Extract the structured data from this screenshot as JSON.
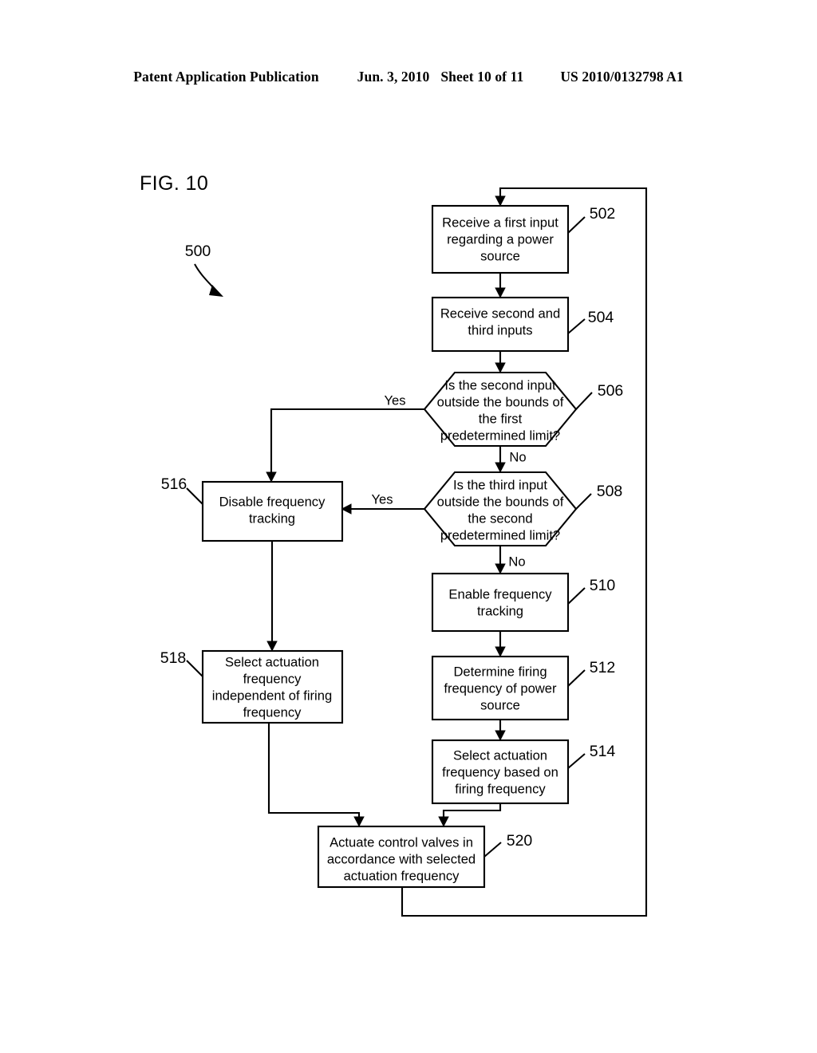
{
  "header": {
    "title": "Patent Application Publication",
    "date": "Jun. 3, 2010",
    "sheet": "Sheet 10 of 11",
    "publication_number": "US 2010/0132798 A1"
  },
  "figure": {
    "label": "FIG. 10",
    "diagram_reference": "500"
  },
  "colors": {
    "ink": "#000000",
    "paper": "#ffffff"
  },
  "flowchart": {
    "type": "flowchart",
    "nodes": [
      {
        "id": "502",
        "shape": "process",
        "ref": "502",
        "lines": [
          "Receive a first input",
          "regarding a power",
          "source"
        ]
      },
      {
        "id": "504",
        "shape": "process",
        "ref": "504",
        "lines": [
          "Receive second and",
          "third inputs"
        ]
      },
      {
        "id": "506",
        "shape": "decision",
        "ref": "506",
        "lines": [
          "Is the second input",
          "outside the bounds of",
          "the first",
          "predetermined limit?"
        ]
      },
      {
        "id": "508",
        "shape": "decision",
        "ref": "508",
        "lines": [
          "Is the third input",
          "outside the bounds of",
          "the second",
          "predetermined limit?"
        ]
      },
      {
        "id": "510",
        "shape": "process",
        "ref": "510",
        "lines": [
          "Enable frequency",
          "tracking"
        ]
      },
      {
        "id": "512",
        "shape": "process",
        "ref": "512",
        "lines": [
          "Determine firing",
          "frequency of power",
          "source"
        ]
      },
      {
        "id": "514",
        "shape": "process",
        "ref": "514",
        "lines": [
          "Select actuation",
          "frequency based on",
          "firing frequency"
        ]
      },
      {
        "id": "516",
        "shape": "process",
        "ref": "516",
        "lines": [
          "Disable frequency",
          "tracking"
        ]
      },
      {
        "id": "518",
        "shape": "process",
        "ref": "518",
        "lines": [
          "Select actuation",
          "frequency",
          "independent of firing",
          "frequency"
        ]
      },
      {
        "id": "520",
        "shape": "process",
        "ref": "520",
        "lines": [
          "Actuate control valves in",
          "accordance with selected",
          "actuation frequency"
        ]
      }
    ],
    "edges": [
      {
        "from": "502",
        "to": "504",
        "label": ""
      },
      {
        "from": "504",
        "to": "506",
        "label": ""
      },
      {
        "from": "506",
        "to": "516",
        "label": "Yes"
      },
      {
        "from": "506",
        "to": "508",
        "label": "No"
      },
      {
        "from": "508",
        "to": "516",
        "label": "Yes"
      },
      {
        "from": "508",
        "to": "510",
        "label": "No"
      },
      {
        "from": "510",
        "to": "512",
        "label": ""
      },
      {
        "from": "512",
        "to": "514",
        "label": ""
      },
      {
        "from": "514",
        "to": "520",
        "label": ""
      },
      {
        "from": "516",
        "to": "518",
        "label": ""
      },
      {
        "from": "518",
        "to": "520",
        "label": ""
      },
      {
        "from": "520",
        "to": "502",
        "label": ""
      }
    ],
    "edge_labels": {
      "yes_506": "Yes",
      "no_506": "No",
      "yes_508": "Yes",
      "no_508": "No"
    }
  }
}
